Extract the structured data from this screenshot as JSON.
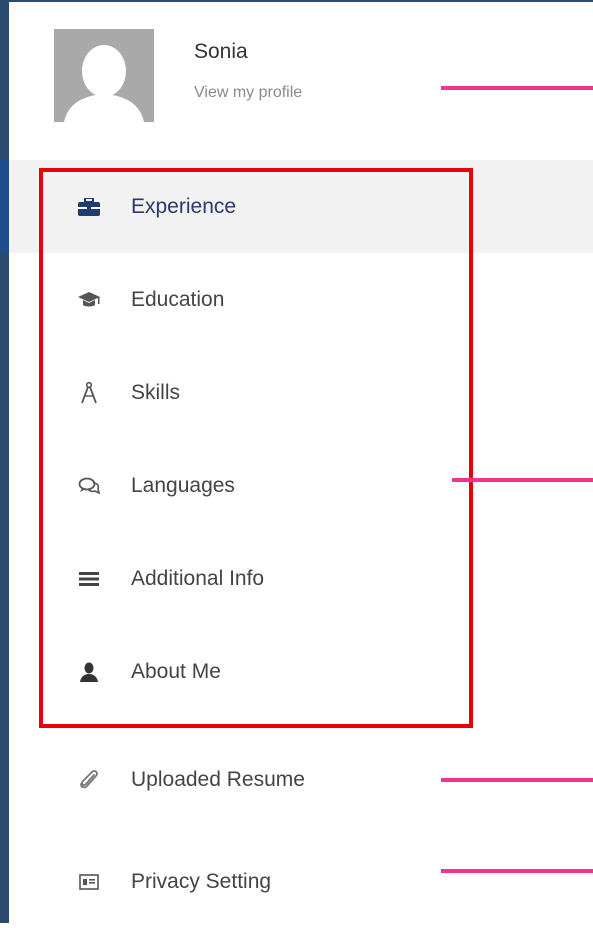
{
  "profile": {
    "name": "Sonia",
    "link": "View my profile"
  },
  "menu": {
    "items": [
      {
        "label": "Experience",
        "icon": "briefcase-icon",
        "active": true
      },
      {
        "label": "Education",
        "icon": "graduation-cap-icon",
        "active": false
      },
      {
        "label": "Skills",
        "icon": "compass-icon",
        "active": false
      },
      {
        "label": "Languages",
        "icon": "speech-bubbles-icon",
        "active": false
      },
      {
        "label": "Additional Info",
        "icon": "list-lines-icon",
        "active": false
      },
      {
        "label": "About Me",
        "icon": "user-icon",
        "active": false
      },
      {
        "label": "Uploaded Resume",
        "icon": "paperclip-icon",
        "active": false
      },
      {
        "label": "Privacy Setting",
        "icon": "id-card-icon",
        "active": false
      }
    ]
  },
  "colors": {
    "active_bar": "#1f4e8c",
    "active_label": "#2b3a6b",
    "highlight_box": "#e8000b",
    "callout_line": "#f0358f",
    "frame_border": "#2a4a6e"
  }
}
